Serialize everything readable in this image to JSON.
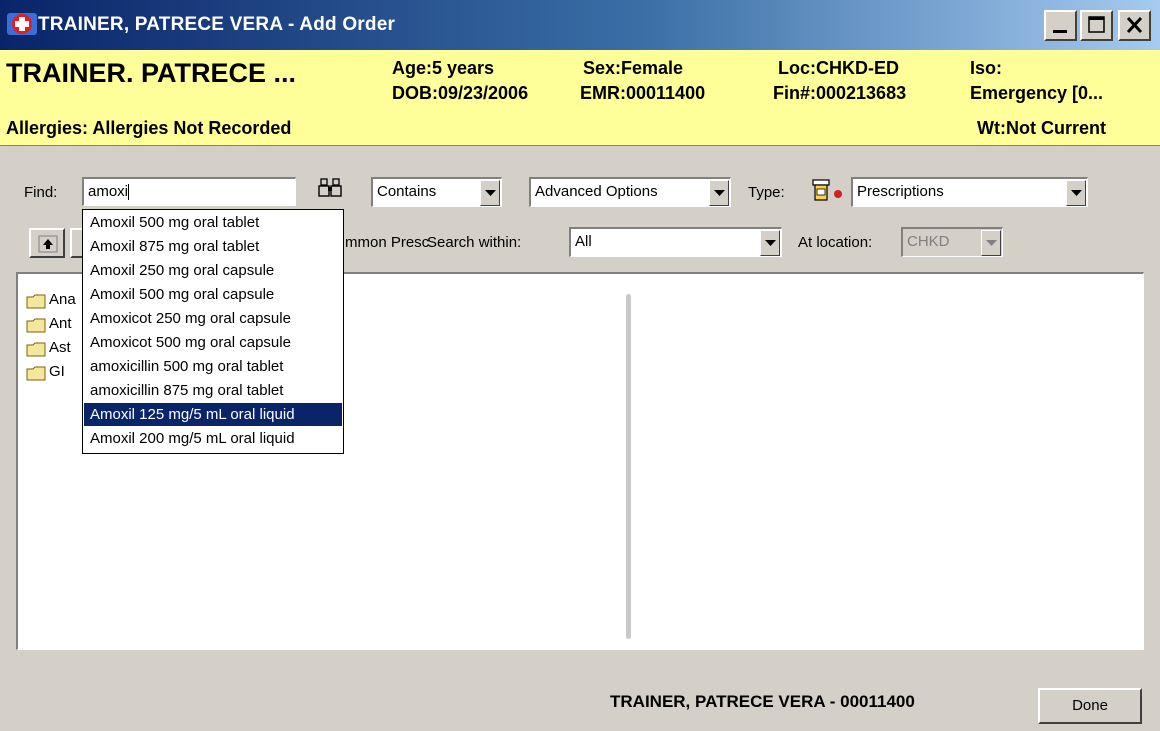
{
  "window": {
    "title": "TRAINER, PATRECE VERA - Add Order",
    "controls": {
      "minimize": "minimize",
      "maximize": "maximize",
      "close": "close"
    }
  },
  "banner": {
    "name": "TRAINER. PATRECE ...",
    "age": "Age:5 years",
    "dob": "DOB:09/23/2006",
    "sex": "Sex:Female",
    "emr": "EMR:00011400",
    "loc": "Loc:CHKD-ED",
    "fin": "Fin#:000213683",
    "iso": "Iso:",
    "encounter": "Emergency [0...",
    "allergies": "Allergies: Allergies Not Recorded",
    "weight": "Wt:Not Current"
  },
  "search": {
    "find_label": "Find:",
    "find_value": "amoxi",
    "match_mode": "Contains",
    "advanced": "Advanced Options",
    "type_label": "Type:",
    "type_value": "Prescriptions",
    "folder_text": "mmon Presc",
    "search_within_label": "Search within:",
    "search_within_value": "All",
    "location_label": "At location:",
    "location_value": "CHKD"
  },
  "suggestions": [
    "Amoxil 500 mg oral tablet",
    "Amoxil 875 mg oral tablet",
    "Amoxil 250 mg oral capsule",
    "Amoxil 500 mg oral capsule",
    "Amoxicot 250 mg oral capsule",
    "Amoxicot 500 mg oral capsule",
    "amoxicillin 500 mg oral tablet",
    "amoxicillin 875 mg oral tablet",
    "Amoxil 125 mg/5 mL oral liquid",
    "Amoxil 200 mg/5 mL oral liquid"
  ],
  "selected_suggestion": "Amoxil 125 mg/5 mL oral liquid",
  "tree": [
    "Ana",
    "Ant",
    "Ast",
    "GI"
  ],
  "footer": {
    "patient": "TRAINER, PATRECE VERA - 00011400",
    "done": "Done"
  },
  "icons": {
    "app": "app-icon",
    "binoculars": "binoculars-icon",
    "prescription": "prescription-bottle-icon",
    "up": "folder-up-icon",
    "folder": "folder-icon"
  },
  "colors": {
    "titlebar": "#0a246a",
    "banner": "#ffff99",
    "selection": "#0a246a",
    "dialog": "#d4d0c8"
  }
}
